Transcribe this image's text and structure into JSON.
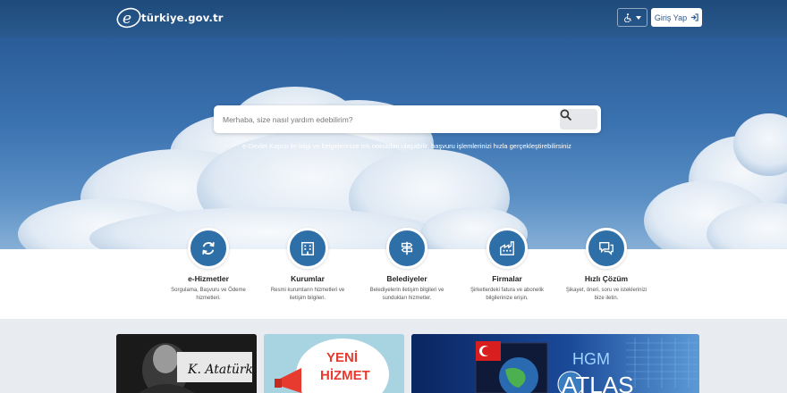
{
  "header": {
    "logo_text": "türkiye.gov.tr",
    "accessibility_icon": "wheelchair-icon",
    "login_label": "Giriş Yap",
    "login_icon": "sign-in-icon"
  },
  "hero": {
    "search_placeholder": "Merhaba, size nasıl yardım edebilirim?",
    "search_icon": "search-icon",
    "tagline": "e-Devlet Kapısı ile bilgi ve belgelerinize tek noktadan ulaşabilir, başvuru işlemlerinizi hızla gerçekleştirebilirsiniz"
  },
  "services": [
    {
      "title": "e-Hizmetler",
      "desc": "Sorgulama, Başvuru ve Ödeme hizmetleri.",
      "icon": "refresh-icon"
    },
    {
      "title": "Kurumlar",
      "desc": "Resmi kurumların hizmetleri ve iletişim bilgileri.",
      "icon": "building-icon"
    },
    {
      "title": "Belediyeler",
      "desc": "Belediyelerin iletişim bilgileri ve sundukları hizmetler.",
      "icon": "signpost-icon"
    },
    {
      "title": "Firmalar",
      "desc": "Şirketlerdeki fatura ve abonelik bilgilerinize erişin.",
      "icon": "factory-icon"
    },
    {
      "title": "Hızlı Çözüm",
      "desc": "Şikayet, öneri, soru ve isteklerinizi bize iletin.",
      "icon": "chat-icon"
    }
  ],
  "banners": {
    "b1_signature": "K. Atatürk",
    "b2_line1": "YENİ",
    "b2_line2": "HİZMET",
    "b3_line1": "HGM",
    "b3_line2": "ATLAS"
  },
  "colors": {
    "header_bg": "#1e4a7a",
    "accent": "#2e6fa8",
    "login_text": "#2a5a8f"
  }
}
